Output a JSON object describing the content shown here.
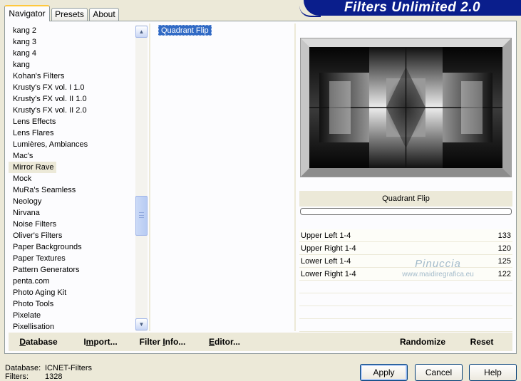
{
  "tabs": [
    "Navigator",
    "Presets",
    "About"
  ],
  "banner": "Filters Unlimited 2.0",
  "categories": [
    "kang 2",
    "kang 3",
    "kang 4",
    "kang",
    "Kohan's Filters",
    "Krusty's FX vol. I 1.0",
    "Krusty's FX vol. II 1.0",
    "Krusty's FX vol. II 2.0",
    "Lens Effects",
    "Lens Flares",
    "Lumières, Ambiances",
    "Mac's",
    "Mirror Rave",
    "Mock",
    "MuRa's Seamless",
    "Neology",
    "Nirvana",
    "Noise Filters",
    "Oliver's Filters",
    "Paper Backgrounds",
    "Paper Textures",
    "Pattern Generators",
    "penta.com",
    "Photo Aging Kit",
    "Photo Tools",
    "Pixelate",
    "Pixellisation"
  ],
  "selected_category_index": 12,
  "filters": [
    "Quadrant Flip"
  ],
  "filter_caption": "Quadrant Flip",
  "params": [
    {
      "name": "Upper Left 1-4",
      "value": "133"
    },
    {
      "name": "Upper Right 1-4",
      "value": "120"
    },
    {
      "name": "Lower Left 1-4",
      "value": "125"
    },
    {
      "name": "Lower Right 1-4",
      "value": "122"
    }
  ],
  "watermark": {
    "line1": "Pinuccia",
    "line2": "www.maidiregrafica.eu"
  },
  "bottom_buttons": {
    "database": {
      "pre": "D",
      "rest": "atabase"
    },
    "import": {
      "pre": "I",
      "mid": "m",
      "rest": "port..."
    },
    "filter_info": {
      "pre": "Filter ",
      "mid": "I",
      "rest": "nfo..."
    },
    "editor": {
      "pre": "E",
      "rest": "ditor..."
    },
    "randomize": "Randomize",
    "reset": "Reset"
  },
  "info": {
    "database_label": "Database:",
    "database_value": "ICNET-Filters",
    "filters_label": "Filters:",
    "filters_value": "1328"
  },
  "dialog_buttons": {
    "apply": "Apply",
    "cancel": "Cancel",
    "help": "Help"
  },
  "colors": {
    "accent": "#0a1e8c",
    "selection": "#316ac5",
    "face": "#ece9d8"
  }
}
